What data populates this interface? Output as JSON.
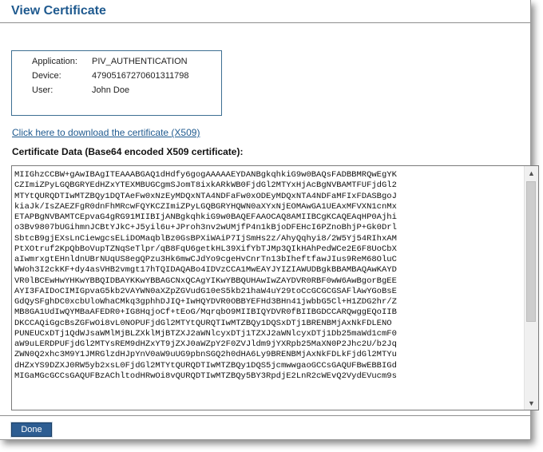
{
  "header": {
    "title": "View Certificate"
  },
  "info": {
    "application_label": "Application:",
    "application_value": "PIV_AUTHENTICATION",
    "device_label": "Device:",
    "device_value": "47905167270601311798",
    "user_label": "User:",
    "user_value": "John Doe"
  },
  "download_link": "Click here to download the certificate (X509)",
  "cert_heading": "Certificate Data (Base64 encoded X509 certificate):",
  "cert_data": "MIIGhzCCBW+gAwIBAgITEAAABGAQ1dHdfy6gogAAAAAEYDANBgkqhkiG9w0BAQsFADBBMRQwEgYK\nCZImiZPyLGQBGRYEdHZxYTEXMBUGCgmSJomT8ixkARkWB0FjdGl2MTYxHjAcBgNVBAMTFUFjdGl2\nMTYtQURQDTIwMTZBQy1DQTAeFw0xNzEyMDQxNTA4NDFaFw0xODEyMDQxNTA4NDFaMFIxFDASBgoJ\nkiaJk/IsZAEZFgR0dnFhMRcwFQYKCZImiZPyLGQBGRYHQWN0aXYxNjEOMAwGA1UEAxMFVXN1cnMx\nETAPBgNVBAMTCEpvaG4gRG91MIIBIjANBgkqhkiG9w0BAQEFAAOCAQ8AMIIBCgKCAQEAqHP0Ajhi\no3Bv9807bUGihmnJCBtYJkC+J5yil6u+JProh3nv2wUMjfP4n1kBjoDFEHcI6PZnoBhjP+Gk0Drl\nSbtcB9gjEXsLnCiewgcsELiDOMaqblBz0GsBPXiWAiP7IjSmHs2z/AhyQqhyi8/2W5Yj54RIhxAM\nPtXOtruf2KpQbBoVupTZNqSeTlpr/qB8FqU6getkHL39XifYbTJMp3QIkHAhPedWCe2E6F8UoCbX\naIwmrxgtEHnldnUBrNUqUS8egQPzu3Hk6mwCJdYo9cgeHvCnrTn13bIheftfawJIus9ReM68OluC\nWWoh3I2ckKF+dy4asVHB2vmgt17hTQIDAQABo4IDVzCCA1MwEAYJYIZIAWUDBgkBBAMBAQAwKAYD\nVR0lBCEwHwYHKwYBBQIDBAYKKwYBBAGCNxQCAgYIKwYBBQUHAwIwZAYDVR0RBF0wW6AwBgorBgEE\nAYI3FAIDoCIMIGpvaG5kb2VAYWN0aXZpZGVudG10eS5kb21haW4uY29toCcGCGCGSAFlAwYGoBsE\nGdQySFghDC0xcbUloWhaCMkq3gphhDJIQ+IwHQYDVR0OBBYEFHd3BHn41jwbbG5Cl+H1ZDG2hr/Z\nMB8GA1UdIwQYMBaAFEDR0+IG8HqjoCf+tEoG/MqrqbO9MIIBIQYDVR0fBIIBGDCCARQwggEQoIIB\nDKCCAQiGgcBsZGFwOi8vL0NOPUFjdGl2MTYtQURQTIwMTZBQy1DQSxDTj1BRENBMjAxNkFDLENO\nPUNEUCxDTj1QdWJsaWMlMjBLZXklMjBTZXJ2aWNlcyxDTj1TZXJ2aWNlcyxDTj1Db25maWd1cmF0\naW9uLERDPUFjdGl2MTYsREM9dHZxYT9jZXJ0aWZpY2F0ZVJldm9jYXRpb25MaXN0P2Jhc2U/b2Jq\nZWN0Q2xhc3M9Y1JMRGlzdHJpYnV0aW9uUG9pbnSGQ2h0dHA6Ly9BRENBMjAxNkFDLkFjdGl2MTYu\ndHZxYS9DZXJ0RW5yb2xsL0FjdGl2MTYtQURQDTIwMTZBQy1DQS5jcmwwgaoGCCsGAQUFBwEBBIGd\nMIGaMGcGCCsGAQUFBzAChltodHRwOi8vQURQDTIwMTZBQy5BY3RpdjE2LnR2cWEvQ2VydEVucm9s"
}
